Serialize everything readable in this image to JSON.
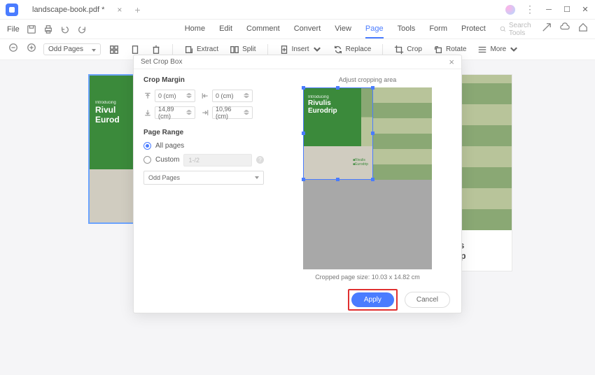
{
  "titlebar": {
    "tab_name": "landscape-book.pdf *"
  },
  "menubar": {
    "file": "File",
    "menus": [
      "Home",
      "Edit",
      "Comment",
      "Convert",
      "View",
      "Page",
      "Tools",
      "Form",
      "Protect"
    ],
    "active_index": 5,
    "search_placeholder": "Search Tools"
  },
  "toolbar": {
    "page_select": "Odd Pages",
    "extract": "Extract",
    "split": "Split",
    "insert": "Insert",
    "replace": "Replace",
    "crop": "Crop",
    "rotate": "Rotate",
    "more": "More"
  },
  "page_preview": {
    "intro": "Introducing",
    "title1": "Rivul",
    "title2": "Eurod",
    "right_title1": "ulis",
    "right_title2": "drip"
  },
  "dialog": {
    "title": "Set Crop Box",
    "crop_margin_label": "Crop Margin",
    "margin_top": "0 (cm)",
    "margin_left": "0 (cm)",
    "margin_bottom": "14,89 (cm)",
    "margin_right": "10,96 (cm)",
    "page_range_label": "Page Range",
    "all_pages": "All pages",
    "custom": "Custom",
    "custom_placeholder": "1-/2",
    "range_select": "Odd Pages",
    "adjust_label": "Adjust cropping area",
    "crop_intro": "Introducing",
    "crop_title1": "Rivulis",
    "crop_title2": "Eurodrip",
    "crop_logo1": "■Rivulis",
    "crop_logo2": "■Eurodrip",
    "cropped_size": "Cropped page size: 10.03 x 14.82 cm",
    "apply": "Apply",
    "cancel": "Cancel"
  }
}
